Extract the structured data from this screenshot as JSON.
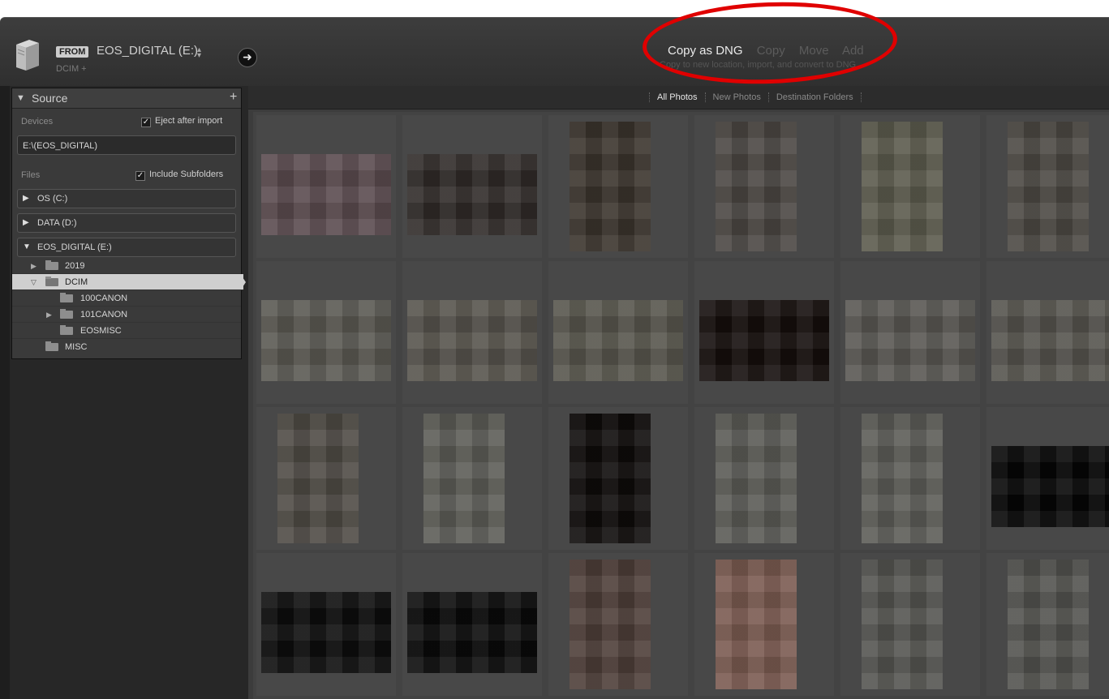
{
  "header": {
    "from_badge": "FROM",
    "device_title": "EOS_DIGITAL (E:)",
    "path_sub": "DCIM +",
    "modes": [
      {
        "label": "Copy as DNG",
        "active": true
      },
      {
        "label": "Copy",
        "active": false
      },
      {
        "label": "Move",
        "active": false
      },
      {
        "label": "Add",
        "active": false
      }
    ],
    "mode_description": "Copy to new location, import, and convert to DNG",
    "annotation_color": "#e00000"
  },
  "source_panel": {
    "title": "Source",
    "devices_label": "Devices",
    "eject_label": "Eject after import",
    "eject_checked": true,
    "device_path": "E:\\(EOS_DIGITAL)",
    "files_label": "Files",
    "include_subfolders_label": "Include Subfolders",
    "include_subfolders_checked": true,
    "drives": [
      {
        "label": "OS (C:)",
        "expanded": false
      },
      {
        "label": "DATA (D:)",
        "expanded": false
      },
      {
        "label": "EOS_DIGITAL (E:)",
        "expanded": true
      }
    ],
    "folders": [
      {
        "label": "2019",
        "level": 1,
        "twisty": "▶",
        "selected": false
      },
      {
        "label": "DCIM",
        "level": 1,
        "twisty": "▽",
        "selected": true
      },
      {
        "label": "100CANON",
        "level": 2,
        "twisty": "",
        "selected": false
      },
      {
        "label": "101CANON",
        "level": 2,
        "twisty": "▶",
        "selected": false
      },
      {
        "label": "EOSMISC",
        "level": 2,
        "twisty": "",
        "selected": false
      },
      {
        "label": "MISC",
        "level": 1,
        "twisty": "",
        "selected": false
      }
    ]
  },
  "content": {
    "tabs": [
      {
        "label": "All Photos",
        "active": true
      },
      {
        "label": "New Photos",
        "active": false
      },
      {
        "label": "Destination Folders",
        "active": false
      }
    ],
    "thumbnails": [
      {
        "tone": "#5a4a4e",
        "orientation": "landscape"
      },
      {
        "tone": "#2f2a28",
        "orientation": "landscape"
      },
      {
        "tone": "#3a342c",
        "orientation": "portrait"
      },
      {
        "tone": "#4a4642",
        "orientation": "portrait"
      },
      {
        "tone": "#5b5a4c",
        "orientation": "portrait"
      },
      {
        "tone": "#4b4843",
        "orientation": "portrait"
      },
      {
        "tone": "#5a5852",
        "orientation": "landscape"
      },
      {
        "tone": "#56534c",
        "orientation": "landscape"
      },
      {
        "tone": "#57554c",
        "orientation": "landscape"
      },
      {
        "tone": "#140e0c",
        "orientation": "landscape"
      },
      {
        "tone": "#585652",
        "orientation": "landscape"
      },
      {
        "tone": "#55534d",
        "orientation": "landscape"
      },
      {
        "tone": "#4e4a44",
        "orientation": "portrait"
      },
      {
        "tone": "#5c5c56",
        "orientation": "portrait"
      },
      {
        "tone": "#0e0b0a",
        "orientation": "portrait"
      },
      {
        "tone": "#5a5a55",
        "orientation": "portrait"
      },
      {
        "tone": "#5c5c57",
        "orientation": "portrait"
      },
      {
        "tone": "#050505",
        "orientation": "landscape"
      },
      {
        "tone": "#0d0d0d",
        "orientation": "landscape"
      },
      {
        "tone": "#0a0a0a",
        "orientation": "landscape"
      },
      {
        "tone": "#4d3d38",
        "orientation": "portrait"
      },
      {
        "tone": "#7a5a50",
        "orientation": "portrait"
      },
      {
        "tone": "#545450",
        "orientation": "portrait"
      },
      {
        "tone": "#52524e",
        "orientation": "portrait"
      }
    ]
  }
}
